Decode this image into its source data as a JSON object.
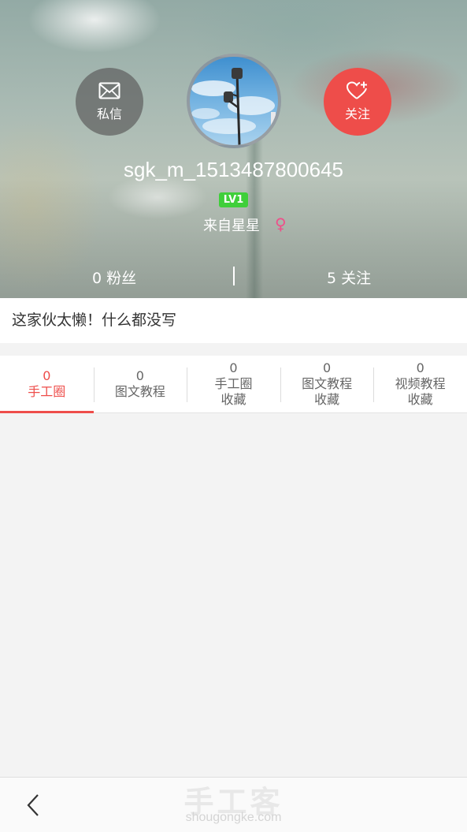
{
  "profile": {
    "username": "sgk_m_1513487800645",
    "level": "LV1",
    "origin": "来自星星",
    "gender_symbol": "♀",
    "message_label": "私信",
    "follow_label": "关注",
    "fans": "0 粉丝",
    "following": "5 关注",
    "bio": "这家伙太懒！什么都没写"
  },
  "tabs": [
    {
      "count": "0",
      "label_line1": "手工圈",
      "label_line2": "",
      "active": true
    },
    {
      "count": "0",
      "label_line1": "图文教程",
      "label_line2": "",
      "active": false
    },
    {
      "count": "0",
      "label_line1": "手工圈",
      "label_line2": "收藏",
      "active": false
    },
    {
      "count": "0",
      "label_line1": "图文教程",
      "label_line2": "收藏",
      "active": false
    },
    {
      "count": "0",
      "label_line1": "视频教程",
      "label_line2": "收藏",
      "active": false
    }
  ],
  "footer": {
    "brand_cn": "手工客",
    "brand_en": "shougongke.com"
  },
  "colors": {
    "accent": "#ee4d4a",
    "level_badge": "#3fcf3a",
    "gender": "#ef4f8a"
  },
  "icons": {
    "message": "envelope-icon",
    "follow": "heart-plus-icon",
    "back": "chevron-left-icon"
  }
}
